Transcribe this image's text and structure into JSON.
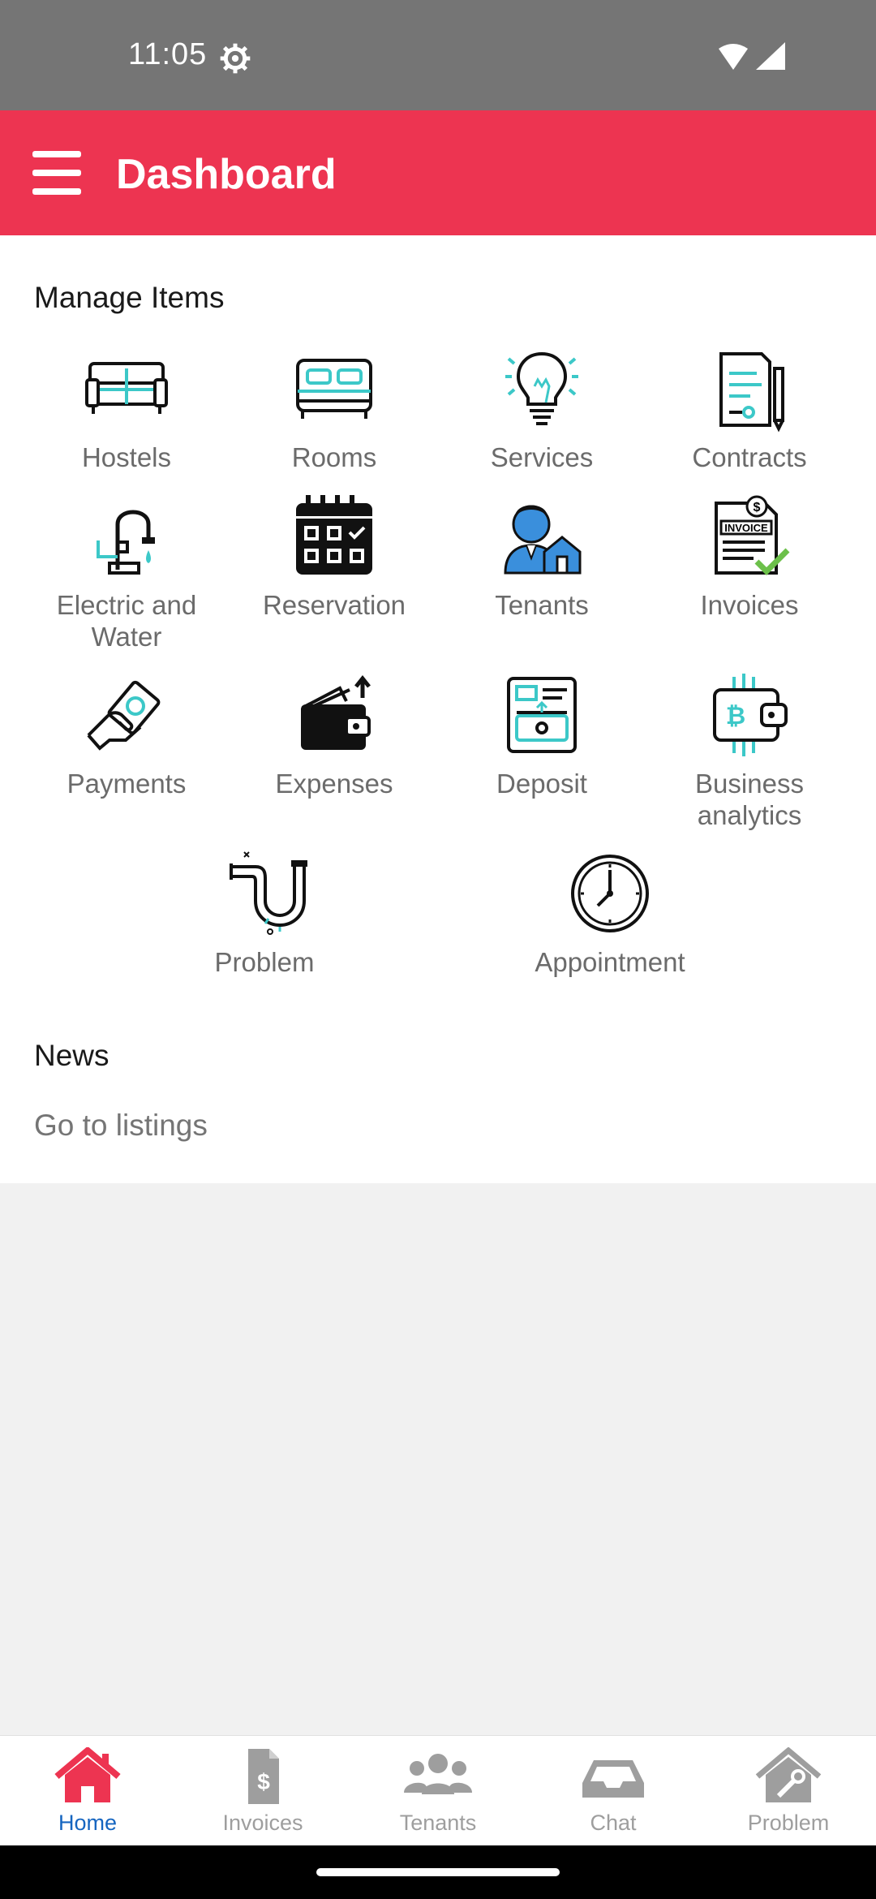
{
  "status": {
    "time": "11:05"
  },
  "appbar": {
    "title": "Dashboard"
  },
  "manage": {
    "title": "Manage Items",
    "items": [
      {
        "label": "Hostels",
        "icon": "sofa-icon"
      },
      {
        "label": "Rooms",
        "icon": "bed-icon"
      },
      {
        "label": "Services",
        "icon": "lightbulb-icon"
      },
      {
        "label": "Contracts",
        "icon": "contract-icon"
      },
      {
        "label": "Electric and\nWater",
        "icon": "faucet-icon"
      },
      {
        "label": "Reservation",
        "icon": "calendar-icon"
      },
      {
        "label": "Tenants",
        "icon": "tenant-icon"
      },
      {
        "label": "Invoices",
        "icon": "invoice-icon"
      },
      {
        "label": "Payments",
        "icon": "payment-hand-icon"
      },
      {
        "label": "Expenses",
        "icon": "wallet-icon"
      },
      {
        "label": "Deposit",
        "icon": "deposit-icon"
      },
      {
        "label": "Business\nanalytics",
        "icon": "bitcoin-wallet-icon"
      },
      {
        "label": "Problem",
        "icon": "pipe-leak-icon"
      },
      {
        "label": "Appointment",
        "icon": "clock-icon"
      }
    ]
  },
  "news": {
    "title": "News",
    "link": "Go to listings"
  },
  "nav": [
    {
      "label": "Home",
      "icon": "home-icon"
    },
    {
      "label": "Invoices",
      "icon": "invoice-doc-icon"
    },
    {
      "label": "Tenants",
      "icon": "users-icon"
    },
    {
      "label": "Chat",
      "icon": "inbox-icon"
    },
    {
      "label": "Problem",
      "icon": "house-tool-icon"
    }
  ],
  "colors": {
    "accent": "#ed3451",
    "active_nav": "#1565c0",
    "teal": "#3cc8c8"
  }
}
